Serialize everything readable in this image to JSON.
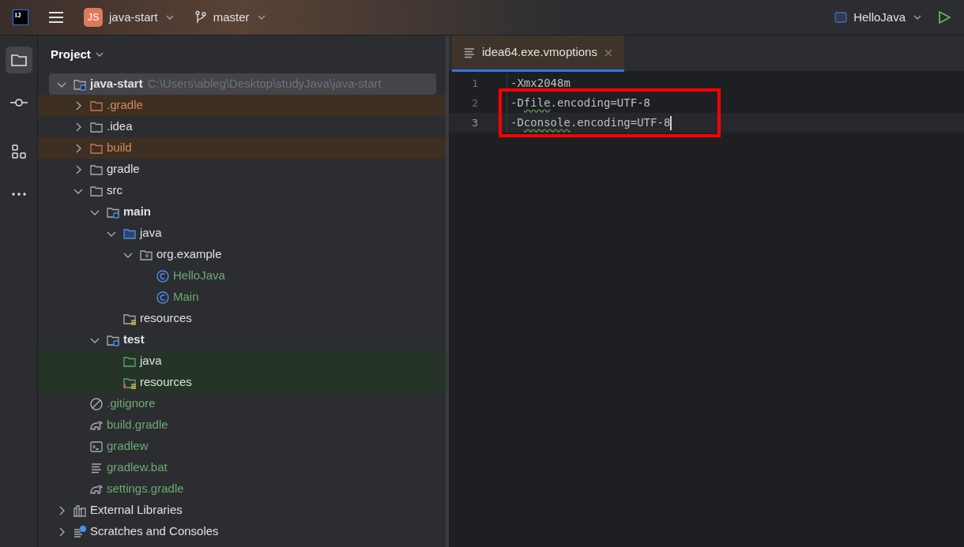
{
  "toolbar": {
    "logo_text": "IJ",
    "project_badge": "JS",
    "project": "java-start",
    "branch": "master",
    "run_config": "HelloJava"
  },
  "tool_strip": [
    {
      "kind": "folder",
      "selected": true
    },
    {
      "kind": "commit",
      "selected": false
    },
    {
      "kind": "structure",
      "selected": false
    },
    {
      "kind": "more",
      "selected": false
    }
  ],
  "project_panel": {
    "title": "Project",
    "tree": [
      {
        "name": "java-start",
        "path": "C:\\Users\\ableg\\Desktop\\studyJava\\java-start",
        "kind": "module",
        "color": "#dfe1e5",
        "bold": true,
        "selected": true,
        "expanded": true,
        "children": [
          {
            "name": ".gradle",
            "kind": "excluded-folder",
            "color": "#d9885a",
            "bold": false,
            "selected": false,
            "expanded": false
          },
          {
            "name": ".idea",
            "kind": "folder",
            "color": "#dfe1e5",
            "bold": false,
            "selected": false,
            "expanded": false
          },
          {
            "name": "build",
            "kind": "excluded-folder",
            "color": "#d9885a",
            "bold": false,
            "selected": false,
            "expanded": false
          },
          {
            "name": "gradle",
            "kind": "folder",
            "color": "#dfe1e5",
            "bold": false,
            "selected": false,
            "expanded": false
          },
          {
            "name": "src",
            "kind": "folder",
            "color": "#dfe1e5",
            "bold": false,
            "selected": false,
            "expanded": true,
            "children": [
              {
                "name": "main",
                "kind": "module",
                "color": "#dfe1e5",
                "bold": true,
                "selected": false,
                "expanded": true,
                "children": [
                  {
                    "name": "java",
                    "kind": "source",
                    "color": "#dfe1e5",
                    "bold": false,
                    "selected": false,
                    "expanded": true,
                    "children": [
                      {
                        "name": "org.example",
                        "kind": "package",
                        "color": "#dfe1e5",
                        "bold": false,
                        "selected": false,
                        "expanded": true,
                        "children": [
                          {
                            "name": "HelloJava",
                            "kind": "class",
                            "color": "#6aab73",
                            "bold": false,
                            "selected": false
                          },
                          {
                            "name": "Main",
                            "kind": "class",
                            "color": "#6aab73",
                            "bold": false,
                            "selected": false
                          }
                        ]
                      }
                    ]
                  },
                  {
                    "name": "resources",
                    "kind": "resources",
                    "color": "#dfe1e5",
                    "bold": false,
                    "selected": false
                  }
                ]
              },
              {
                "name": "test",
                "kind": "module",
                "color": "#dfe1e5",
                "bold": true,
                "selected": false,
                "expanded": true,
                "children": [
                  {
                    "name": "java",
                    "kind": "test-source",
                    "color": "#dfe1e5",
                    "bold": false,
                    "selected": false
                  },
                  {
                    "name": "resources",
                    "kind": "test-resources",
                    "color": "#dfe1e5",
                    "bold": false,
                    "selected": false
                  }
                ]
              }
            ]
          },
          {
            "name": ".gitignore",
            "kind": "ignore",
            "color": "#6aab73",
            "bold": false,
            "selected": false
          },
          {
            "name": "build.gradle",
            "kind": "gradle",
            "color": "#6aab73",
            "bold": false,
            "selected": false
          },
          {
            "name": "gradlew",
            "kind": "terminal",
            "color": "#6aab73",
            "bold": false,
            "selected": false
          },
          {
            "name": "gradlew.bat",
            "kind": "text",
            "color": "#6aab73",
            "bold": false,
            "selected": false
          },
          {
            "name": "settings.gradle",
            "kind": "gradle",
            "color": "#6aab73",
            "bold": false,
            "selected": false
          }
        ]
      },
      {
        "name": "External Libraries",
        "kind": "libraries",
        "color": "#dfe1e5",
        "bold": false,
        "selected": false,
        "expanded": false
      },
      {
        "name": "Scratches and Consoles",
        "kind": "scratches",
        "color": "#dfe1e5",
        "bold": false,
        "selected": false,
        "expanded": false
      }
    ]
  },
  "editor": {
    "tabs": [
      {
        "label": "idea64.exe.vmoptions",
        "selected": true
      }
    ],
    "lines": [
      {
        "number": "1",
        "current": false,
        "boxed": false,
        "segments": [
          {
            "text": "-Xmx2048m"
          }
        ]
      },
      {
        "number": "2",
        "current": false,
        "boxed": true,
        "segments": [
          {
            "text": "-D"
          },
          {
            "text": "file",
            "squiggle": true
          },
          {
            "text": ".encoding=UTF-8"
          }
        ]
      },
      {
        "number": "3",
        "current": true,
        "boxed": true,
        "segments": [
          {
            "text": "-D"
          },
          {
            "text": "console",
            "squiggle": true
          },
          {
            "text": ".encoding=UTF-8"
          }
        ]
      }
    ]
  }
}
